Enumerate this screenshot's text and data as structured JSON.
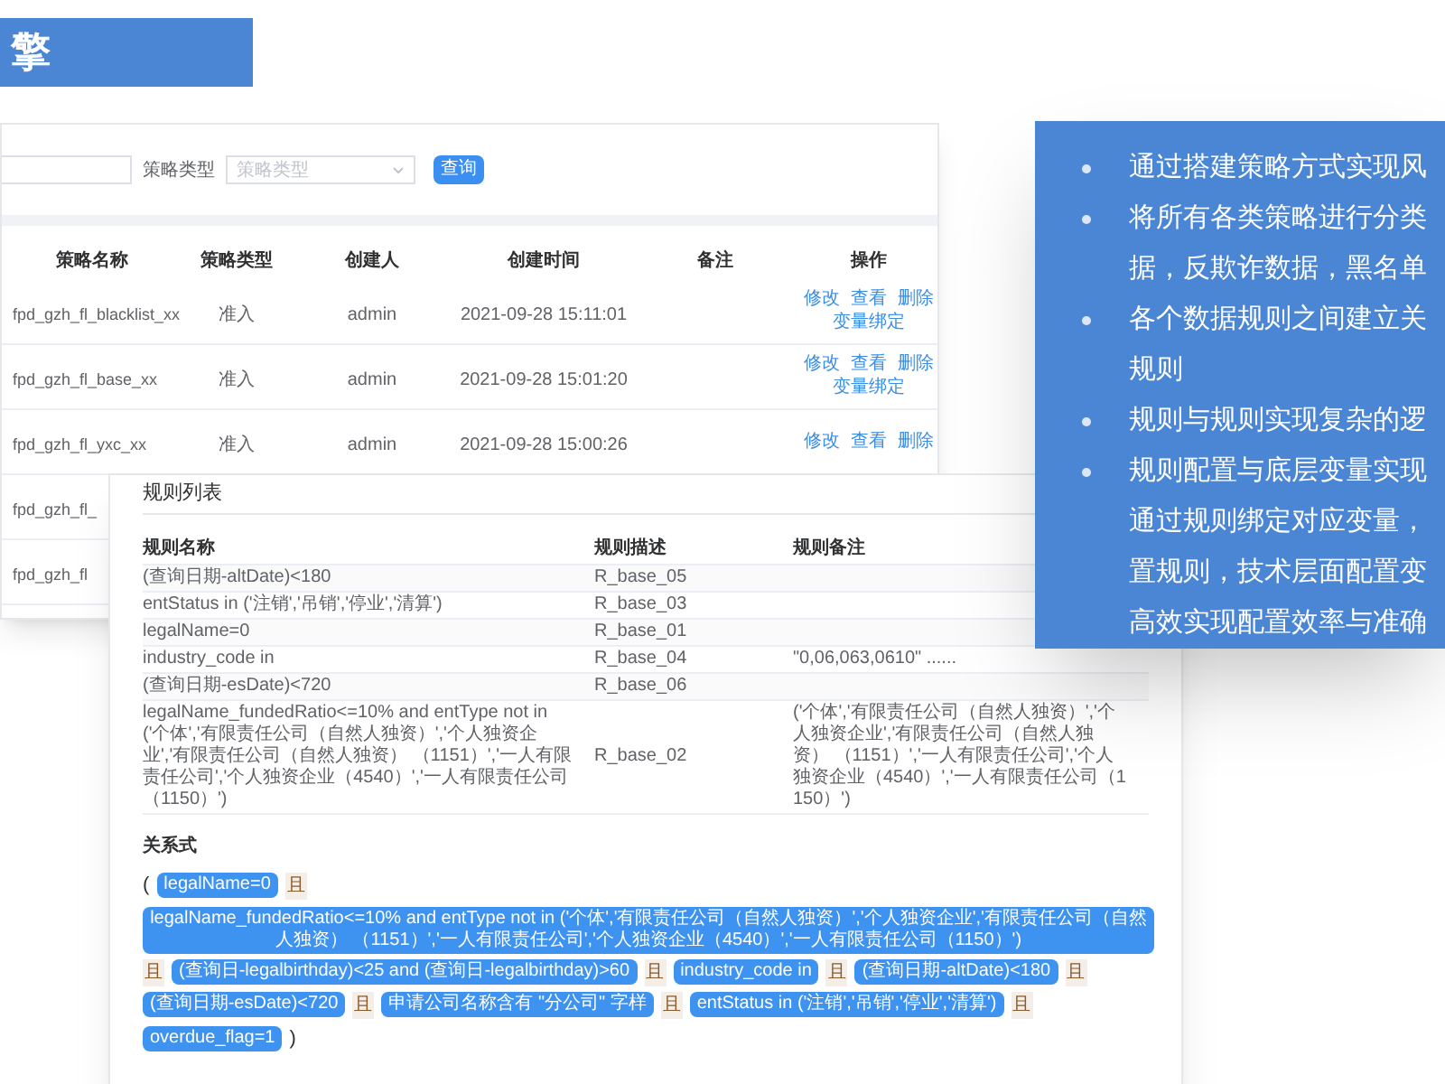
{
  "title": "擎",
  "strategy_list": {
    "search": {
      "type_label": "策略类型",
      "type_placeholder": "策略类型",
      "button": "查询"
    },
    "columns": [
      "策略名称",
      "策略类型",
      "创建人",
      "创建时间",
      "备注",
      "操作"
    ],
    "rows": [
      {
        "name": "fpd_gzh_fl_blacklist_xx",
        "type": "准入",
        "creator": "admin",
        "created": "2021-09-28 15:11:01",
        "actions": [
          "修改",
          "查看",
          "删除"
        ],
        "extra_action": "变量绑定"
      },
      {
        "name": "fpd_gzh_fl_base_xx",
        "type": "准入",
        "creator": "admin",
        "created": "2021-09-28 15:01:20",
        "actions": [
          "修改",
          "查看",
          "删除"
        ],
        "extra_action": "变量绑定"
      },
      {
        "name": "fpd_gzh_fl_yxc_xx",
        "type": "准入",
        "creator": "admin",
        "created": "2021-09-28 15:00:26",
        "actions": [
          "修改",
          "查看",
          "删除"
        ]
      },
      {
        "name": "fpd_gzh_fl_"
      },
      {
        "name": "fpd_gzh_fl"
      }
    ]
  },
  "rule_list": {
    "title": "规则列表",
    "columns": [
      "规则名称",
      "规则描述",
      "规则备注"
    ],
    "rows": [
      {
        "name": "(查询日期-altDate)<180",
        "desc": "R_base_05"
      },
      {
        "name": "entStatus in ('注销','吊销','停业','清算')",
        "desc": "R_base_03"
      },
      {
        "name": "legalName=0",
        "desc": "R_base_01"
      },
      {
        "name": "industry_code in",
        "desc": "R_base_04",
        "note": "\"0,06,063,0610\" ......"
      },
      {
        "name": "(查询日期-esDate)<720",
        "desc": "R_base_06"
      },
      {
        "name": "legalName_fundedRatio<=10% and entType not in ('个体','有限责任公司（自然人独资）','个人独资企业','有限责任公司（自然人独资） （1151）','一人有限责任公司','个人独资企业（4540）','一人有限责任公司（1150）')",
        "desc": "R_base_02",
        "note": "('个体','有限责任公司（自然人独资）','个人独资企业','有限责任公司（自然人独资） （1151）','一人有限责任公司','个人独资企业（4540）','一人有限责任公司（1150）')"
      }
    ],
    "relation_title": "关系式",
    "relation": [
      {
        "kind": "paren",
        "text": "("
      },
      {
        "kind": "term",
        "text": "legalName=0"
      },
      {
        "kind": "joiner",
        "text": "且"
      },
      {
        "kind": "term",
        "text": "legalName_fundedRatio<=10% and entType not in ('个体','有限责任公司（自然人独资）','个人独资企业','有限责任公司（自然人独资） （1151）','一人有限责任公司','个人独资企业（4540）','一人有限责任公司（1150）')"
      },
      {
        "kind": "joiner",
        "text": "且"
      },
      {
        "kind": "term",
        "text": "(查询日-legalbirthday)<25 and (查询日-legalbirthday)>60"
      },
      {
        "kind": "joiner",
        "text": "且"
      },
      {
        "kind": "term",
        "text": "industry_code in"
      },
      {
        "kind": "joiner",
        "text": "且"
      },
      {
        "kind": "term",
        "text": "(查询日期-altDate)<180"
      },
      {
        "kind": "joiner",
        "text": "且"
      },
      {
        "kind": "term",
        "text": "(查询日期-esDate)<720"
      },
      {
        "kind": "joiner",
        "text": "且"
      },
      {
        "kind": "term",
        "text": "申请公司名称含有 \"分公司\" 字样"
      },
      {
        "kind": "joiner",
        "text": "且"
      },
      {
        "kind": "term",
        "text": "entStatus in ('注销','吊销','停业','清算')"
      },
      {
        "kind": "joiner",
        "text": "且"
      },
      {
        "kind": "term",
        "text": "overdue_flag=1"
      },
      {
        "kind": "paren",
        "text": ")"
      }
    ]
  },
  "highlights": [
    {
      "lines": [
        "通过搭建策略方式实现风"
      ]
    },
    {
      "lines": [
        "将所有各类策略进行分类",
        "据，反欺诈数据，黑名单"
      ]
    },
    {
      "lines": [
        "各个数据规则之间建立关",
        "规则"
      ]
    },
    {
      "lines": [
        "规则与规则实现复杂的逻"
      ]
    },
    {
      "lines": [
        "规则配置与底层变量实现",
        "通过规则绑定对应变量，",
        "置规则，技术层面配置变",
        "高效实现配置效率与准确"
      ]
    }
  ]
}
